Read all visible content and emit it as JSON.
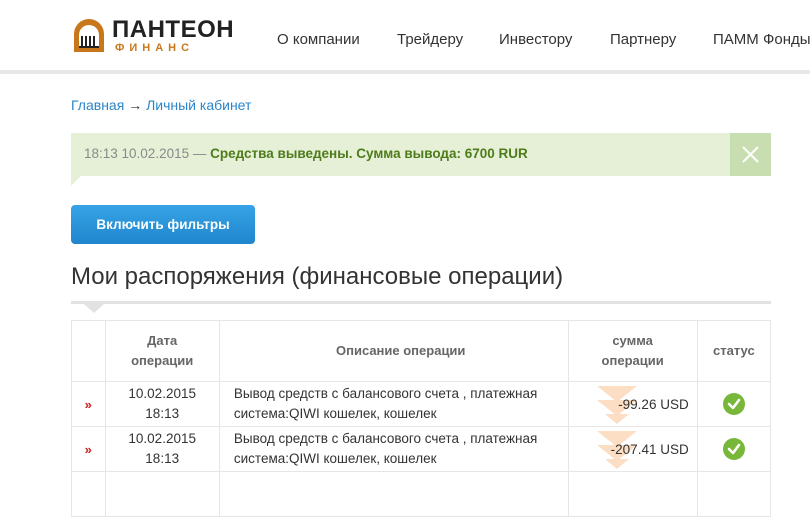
{
  "brand": {
    "name": "ПАНТЕОН",
    "sub": "ФИНАНС"
  },
  "nav": [
    {
      "label": "О компании"
    },
    {
      "label": "Трейдеру"
    },
    {
      "label": "Инвестору"
    },
    {
      "label": "Партнеру"
    },
    {
      "label": "ПАММ Фонды"
    }
  ],
  "breadcrumb": {
    "home": "Главная",
    "separator": "→",
    "current": "Личный кабинет"
  },
  "notice": {
    "time": "18:13 10.02.2015 —",
    "message": "Средства выведены. Сумма вывода: 6700 RUR"
  },
  "filter_button": "Включить фильтры",
  "page_title": "Мои распоряжения (финансовые операции)",
  "table": {
    "headers": {
      "date": [
        "Дата",
        "операции"
      ],
      "description": "Описание операции",
      "amount": [
        "сумма",
        "операции"
      ],
      "status": "статус"
    },
    "rows": [
      {
        "mark": "»",
        "date": "10.02.2015",
        "time": "18:13",
        "desc_line1": "Вывод средств с балансового счета , платежная",
        "desc_line2": "система:QIWI кошелек, кошелек",
        "amount": "-99.26 USD",
        "status": "ok"
      },
      {
        "mark": "»",
        "date": "10.02.2015",
        "time": "18:13",
        "desc_line1": "Вывод средств с балансового счета , платежная",
        "desc_line2": "система:QIWI кошелек, кошелек",
        "amount": "-207.41 USD",
        "status": "ok"
      }
    ]
  },
  "colors": {
    "link": "#2a86c9",
    "notice_bg": "#e5f0d7",
    "notice_text": "#4e7c1a",
    "button": "#2a92d8",
    "status_ok": "#77b73a",
    "row_mark": "#d21f1f",
    "brand_accent": "#c8781b"
  }
}
